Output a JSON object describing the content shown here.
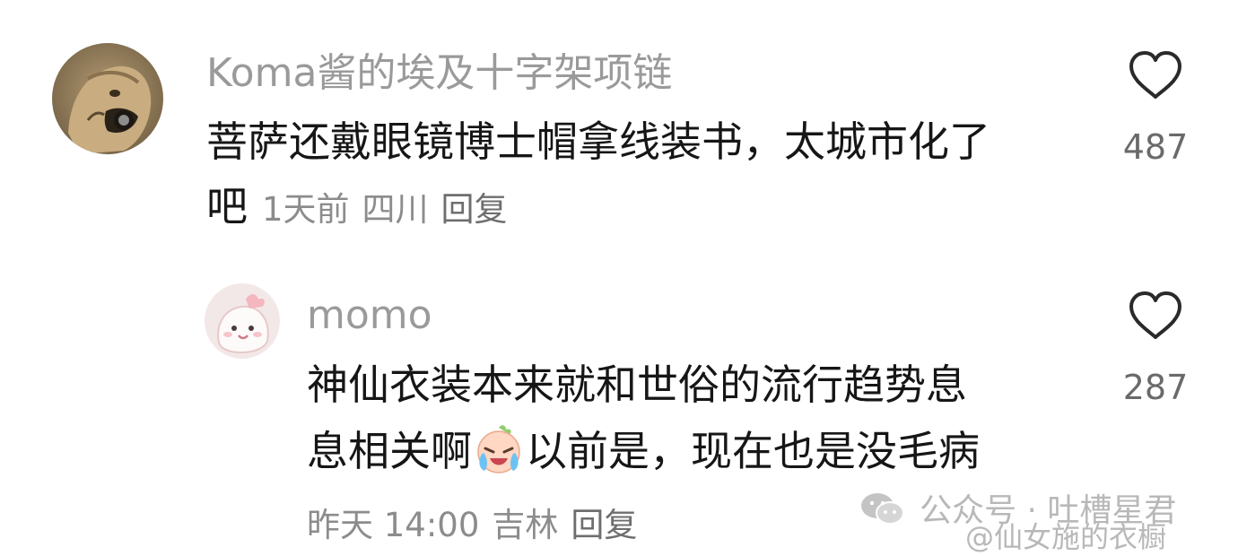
{
  "comments": [
    {
      "username": "Koma酱的埃及十字架项链",
      "content_lines": [
        "菩萨还戴眼镜博士帽拿线装书，太城市化了",
        "吧"
      ],
      "time": "1天前",
      "location": "四川",
      "reply_label": "回复",
      "like_count": "487",
      "avatar_icon": "lion-avatar-icon"
    },
    {
      "username": "momo",
      "content_line1": "神仙衣装本来就和世俗的流行趋势息",
      "content_line2_before": "息相关啊",
      "content_line2_after": "以前是，现在也是没毛病",
      "emoji": "crying-laughing-emoji-icon",
      "time": "昨天 14:00",
      "location": "吉林",
      "reply_label": "回复",
      "like_count": "287",
      "avatar_icon": "pink-blob-avatar-icon"
    }
  ],
  "watermark": {
    "line1": "公众号 · 吐槽星君",
    "line2": "@仙女施的衣橱"
  },
  "colors": {
    "username": "#9a9a9a",
    "content": "#161616",
    "meta": "#8c8c8c",
    "like_count": "#6a6a6a"
  }
}
